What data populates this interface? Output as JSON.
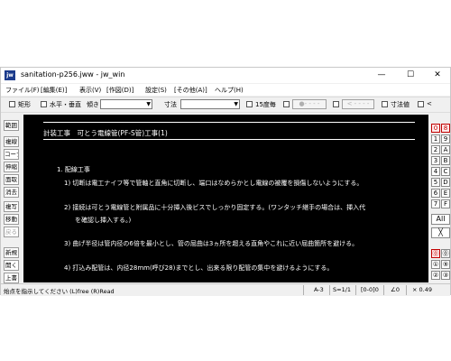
{
  "window": {
    "icon_text": "jw",
    "title": "sanitation-p256.jww - jw_win",
    "minimize": "—",
    "maximize": "☐",
    "close": "✕"
  },
  "menu": [
    "ファイル(F)",
    "[編集(E)]",
    "表示(V)",
    "[作図(D)]",
    "設定(S)",
    "[その他(A)]",
    "ヘルプ(H)"
  ],
  "toolbar": {
    "rect": "矩形",
    "hv": "水平・垂直",
    "slope": "傾き",
    "dim": "寸法",
    "deg15": "15度毎",
    "btn_circle": "●- - - -",
    "btn_arrow": "< - - - -",
    "dimval": "寸法値",
    "less": "<"
  },
  "left_tools": [
    "範囲",
    "複線",
    "コーナー",
    "伸縮",
    "面取",
    "消去",
    "複写",
    "移動",
    "戻る",
    "新規",
    "開く",
    "上書"
  ],
  "canvas": {
    "heading": "計装工事　可とう電線管(PF-S管)工事(1)",
    "section": "1. 配線工事",
    "item1": "1) 切断は電工ナイフ等で管軸と直角に切断し、端口はなめらかとし電線の被覆を損傷しないようにする。",
    "item2a": "2) 接続は可とう電線管と附属品に十分挿入後ビスでしっかり固定する。(ワンタッチ継手の場合は、挿入代",
    "item2b": "を確認し挿入する。)",
    "item3": "3) 曲げ半径は管内径の6倍を最小とし、管の屈曲は3ヵ所を超える直角やこれに近い屈曲箇所を避ける。",
    "item4": "4) 打込み配管は、内径28mm(呼び28)までとし、出来る限り配管の集中を避けるようにする。"
  },
  "right_buttons": {
    "col1": [
      "0",
      "1",
      "2",
      "3",
      "4",
      "5",
      "6",
      "7"
    ],
    "col2": [
      "8",
      "9",
      "A",
      "B",
      "C",
      "D",
      "E",
      "F"
    ],
    "all": "All",
    "cross": "╳",
    "circ1": [
      "⓪",
      "①",
      "②"
    ],
    "circ2": [
      "⓪",
      "⑨",
      "③"
    ]
  },
  "status": {
    "message": "始点を指示してください (L)free (R)Read",
    "paper": "A-3",
    "scale": "S=1/1",
    "layer": "[0-0]0",
    "angle": "∠0",
    "zoom": "× 0.49"
  }
}
